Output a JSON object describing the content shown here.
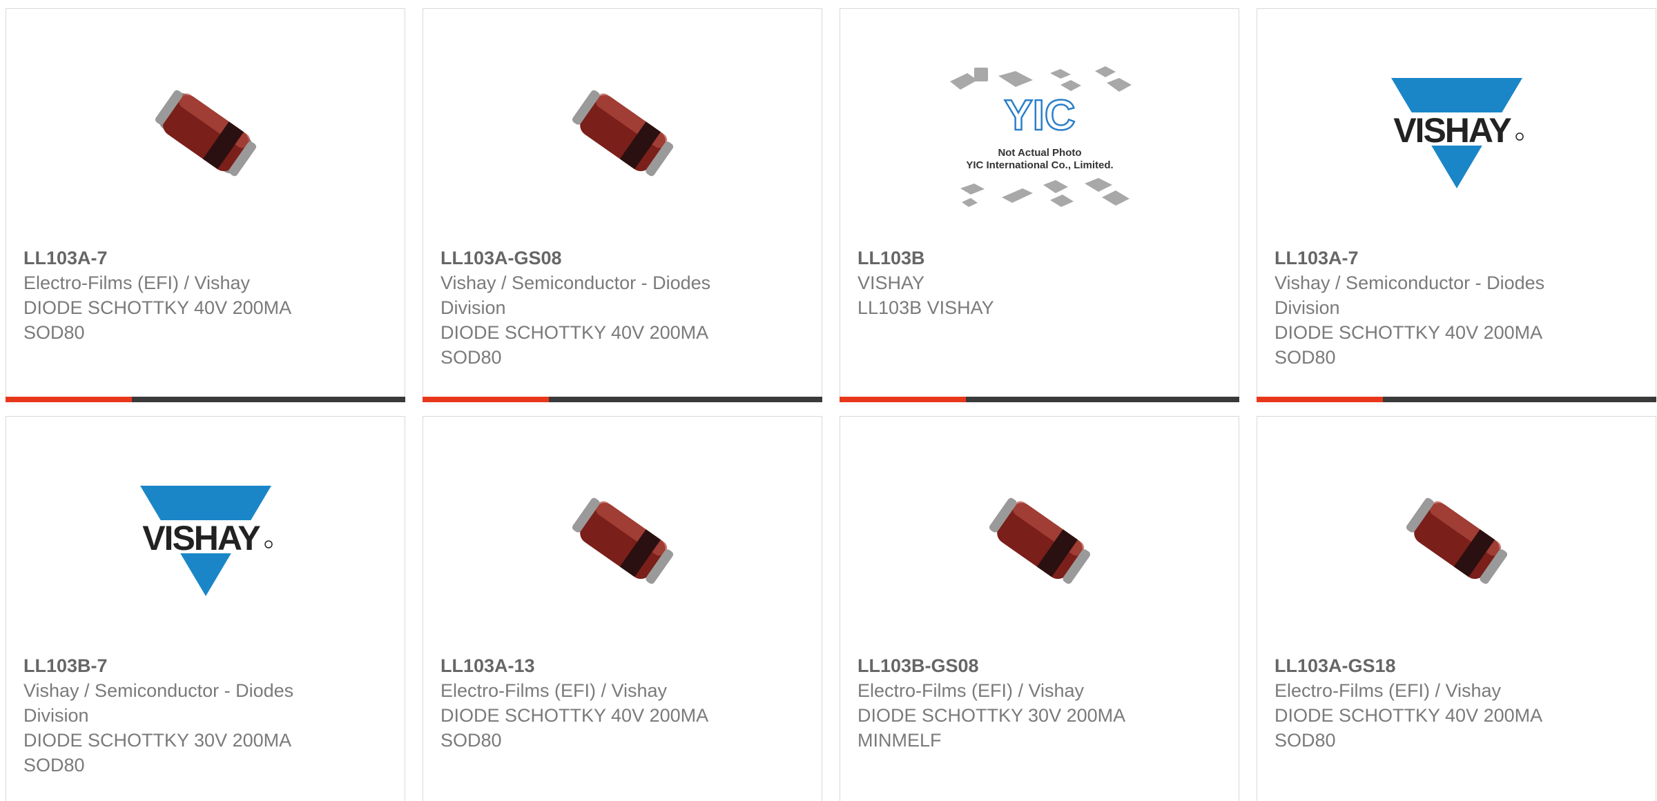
{
  "products": [
    {
      "part": "LL103A-7",
      "image": "diode-photo",
      "lines": [
        "Electro-Films (EFI) / Vishay",
        "DIODE SCHOTTKY 40V 200MA",
        "SOD80"
      ]
    },
    {
      "part": "LL103A-GS08",
      "image": "diode-photo",
      "lines": [
        "Vishay / Semiconductor - Diodes",
        "Division",
        "DIODE SCHOTTKY 40V 200MA",
        "SOD80"
      ]
    },
    {
      "part": "LL103B",
      "image": "yic-placeholder",
      "lines": [
        "VISHAY",
        "LL103B VISHAY"
      ]
    },
    {
      "part": "LL103A-7",
      "image": "vishay-logo",
      "lines": [
        "Vishay / Semiconductor - Diodes",
        "Division",
        "DIODE SCHOTTKY 40V 200MA",
        "SOD80"
      ]
    },
    {
      "part": "LL103B-7",
      "image": "vishay-logo",
      "lines": [
        "Vishay / Semiconductor - Diodes",
        "Division",
        "DIODE SCHOTTKY 30V 200MA",
        "SOD80"
      ]
    },
    {
      "part": "LL103A-13",
      "image": "diode-photo",
      "lines": [
        "Electro-Films (EFI) / Vishay",
        "DIODE SCHOTTKY 40V 200MA",
        "SOD80"
      ]
    },
    {
      "part": "LL103B-GS08",
      "image": "diode-photo",
      "lines": [
        "Electro-Films (EFI) / Vishay",
        "DIODE SCHOTTKY 30V 200MA",
        "MINMELF"
      ]
    },
    {
      "part": "LL103A-GS18",
      "image": "diode-photo",
      "lines": [
        "Electro-Films (EFI) / Vishay",
        "DIODE SCHOTTKY 40V 200MA",
        "SOD80"
      ]
    }
  ],
  "placeholder": {
    "line1": "Not Actual Photo",
    "line2": "YIC International Co., Limited.",
    "logo": "YIC"
  },
  "vishay_logo_text": "VISHAY",
  "colors": {
    "accent": "#e8381c",
    "bar": "#3a3a3a",
    "vishay_blue": "#1a86c8",
    "yic_blue": "#2a7fc9",
    "text": "#777777",
    "title": "#666666"
  }
}
